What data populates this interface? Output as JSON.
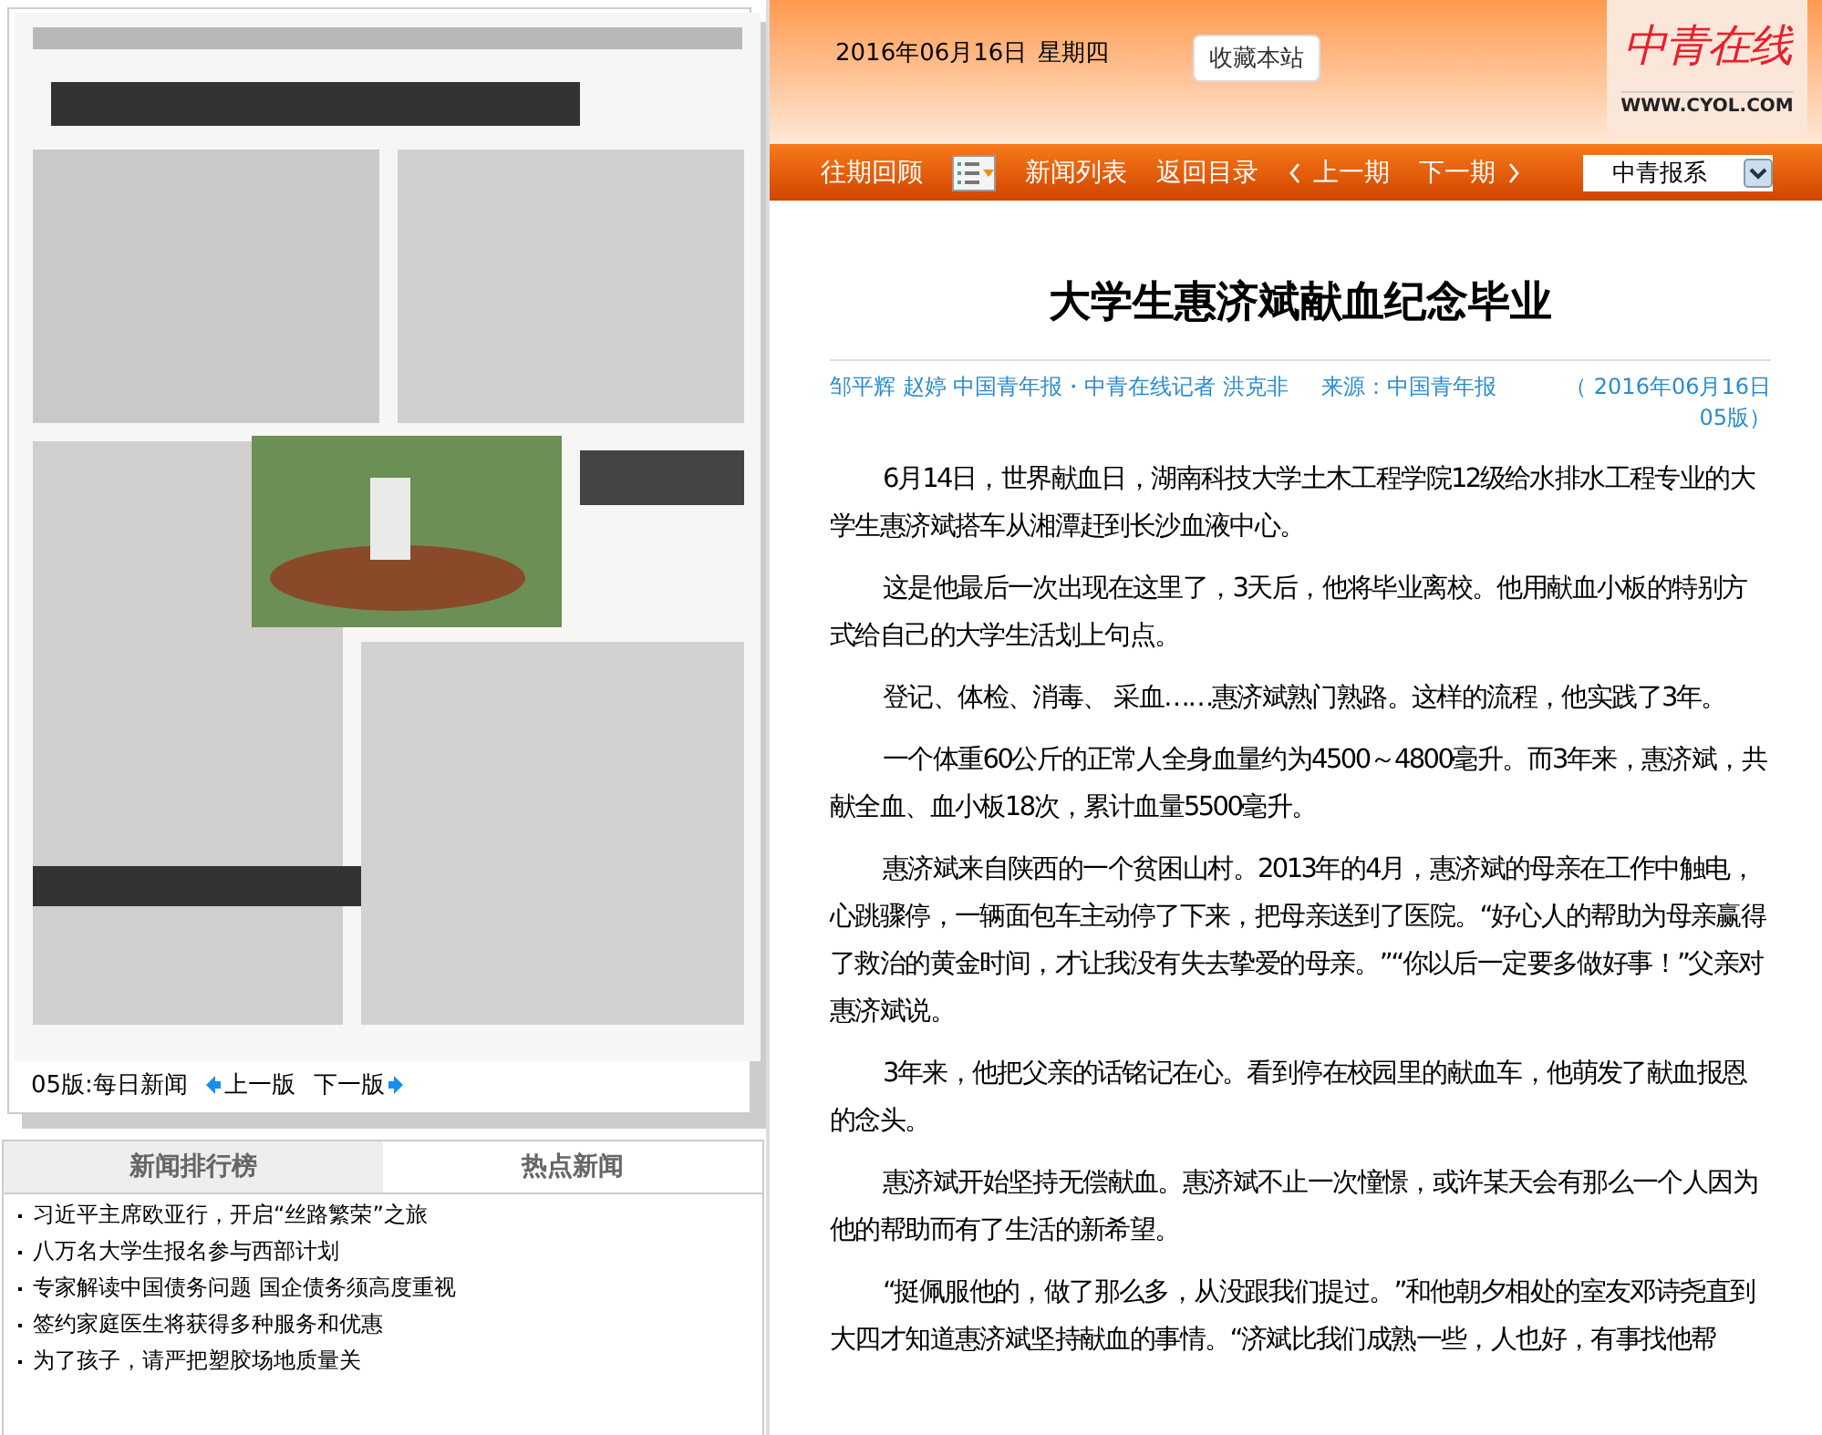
{
  "paper_page": {
    "kind": "picture",
    "edition": "05版:每日新闻",
    "prev_label": "上一版",
    "next_label": "下一版"
  },
  "ranking": {
    "tabs": [
      {
        "label": "新闻排行榜",
        "selected": true
      },
      {
        "label": "热点新闻",
        "selected": false
      }
    ],
    "items": [
      "习近平主席欧亚行，开启“丝路繁荣”之旅",
      "八万名大学生报名参与西部计划",
      "专家解读中国债务问题 国企债务须高度重视",
      "签约家庭医生将获得多种服务和优惠",
      "为了孩子，请严把塑胶场地质量关"
    ]
  },
  "header": {
    "date": "2016年06月16日",
    "weekday": "星期四",
    "bookmark_button": "收藏本站",
    "logo": "中青在线",
    "logo_url": "WWW.CYOL.COM"
  },
  "nav": {
    "archive": "往期回顾",
    "news_list": "新闻列表",
    "back_to_contents": "返回目录",
    "prev_issue": "上一期",
    "next_issue": "下一期",
    "paper_select": "中青报系"
  },
  "article": {
    "title": "大学生惠济斌献血纪念毕业",
    "authors": "邹平辉 赵婷 中国青年报・中青在线记者 洪克非",
    "source": "来源：中国青年报",
    "date": "（ 2016年06月16日 05版）",
    "paragraphs": [
      "6月14日，世界献血日，湖南科技大学土木工程学院12级给水排水工程专业的大学生惠济斌搭车从湘潭赶到长沙血液中心。",
      "这是他最后一次出现在这里了，3天后，他将毕业离校。他用献血小板的特别方式给自己的大学生活划上句点。",
      "登记、体检、消毒、 采血……惠济斌熟门熟路。这样的流程，他实践了3年。",
      "一个体重60公斤的正常人全身血量约为4500～4800毫升。而3年来，惠济斌，共献全血、血小板18次，累计血量5500毫升。",
      "惠济斌来自陕西的一个贫困山村。2013年的4月，惠济斌的母亲在工作中触电，心跳骤停，一辆面包车主动停了下来，把母亲送到了医院。“好心人的帮助为母亲赢得了救治的黄金时间，才让我没有失去挚爱的母亲。”“你以后一定要多做好事！”父亲对惠济斌说。",
      "3年来，他把父亲的话铭记在心。看到停在校园里的献血车，他萌发了献血报恩的念头。",
      "惠济斌开始坚持无偿献血。惠济斌不止一次憧憬，或许某天会有那么一个人因为他的帮助而有了生活的新希望。",
      "“挺佩服他的，做了那么多，从没跟我们提过。”和他朝夕相处的室友邓诗尧直到大四才知道惠济斌坚持献血的事情。“济斌比我们成熟一些，人也好，有事找他帮"
    ]
  }
}
